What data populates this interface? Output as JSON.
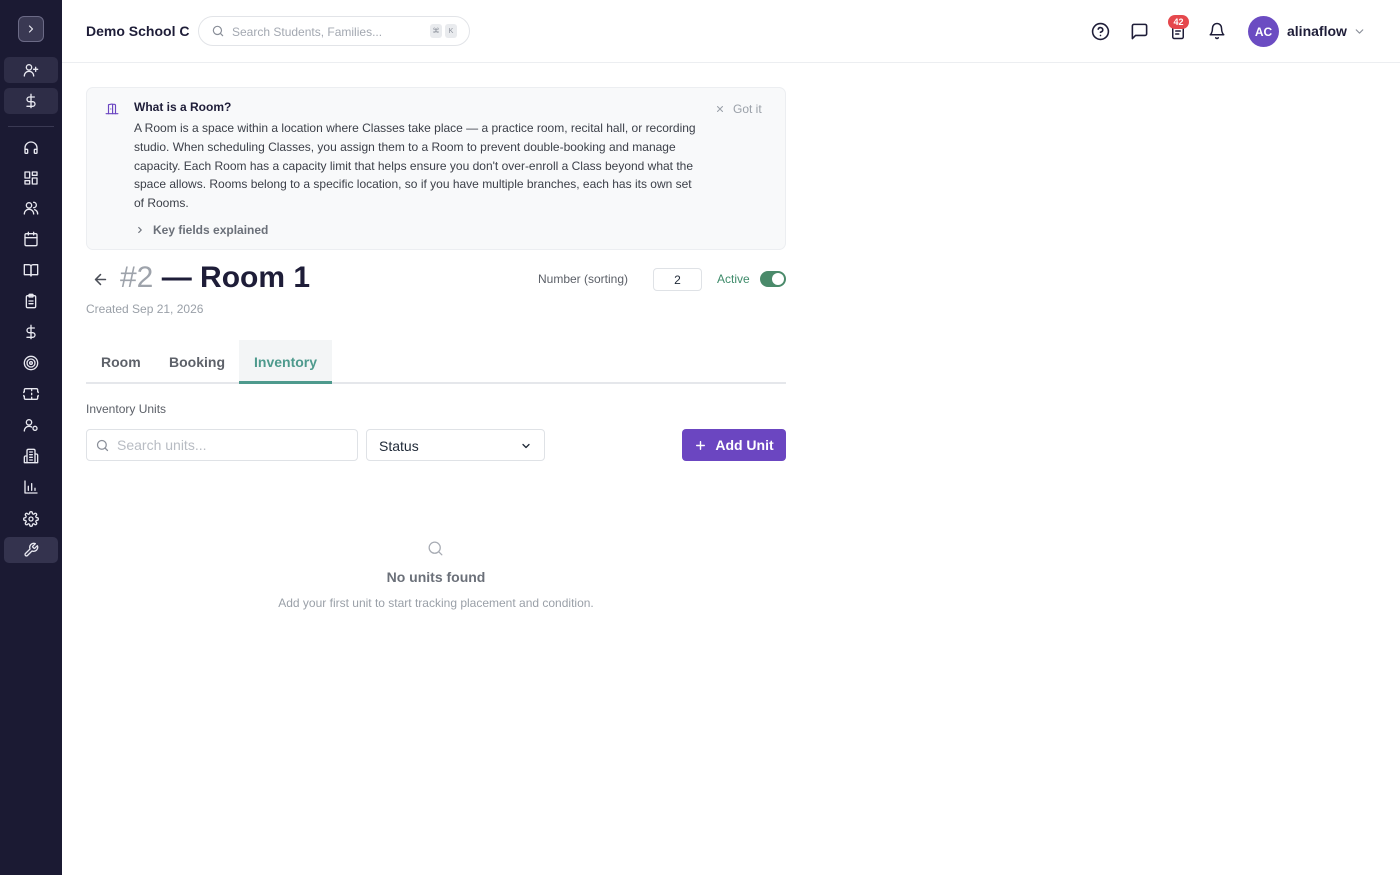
{
  "header": {
    "school_name": "Demo School C",
    "search_placeholder": "Search Students, Families...",
    "shortcut_keys": [
      "⌘",
      "K"
    ],
    "notification_count": "42",
    "user": {
      "initials": "AC",
      "name": "alinaflow"
    }
  },
  "sidebar": {
    "icons": [
      "chevron-right-icon",
      "user-plus-icon",
      "dollar-icon",
      "headset-icon",
      "grid-icon",
      "users-icon",
      "calendar-icon",
      "book-icon",
      "clipboard-icon",
      "dollar-icon",
      "target-icon",
      "ticket-icon",
      "user-cog-icon",
      "building-icon",
      "chart-icon",
      "gear-icon",
      "wrench-icon"
    ],
    "active_item": "wrench-icon"
  },
  "info": {
    "title": "What is a Room?",
    "body": "A Room is a space within a location where Classes take place — a practice room, recital hall, or recording studio. When scheduling Classes, you assign them to a Room to prevent double-booking and manage capacity. Each Room has a capacity limit that helps ensure you don't over-enroll a Class beyond what the space allows. Rooms belong to a specific location, so if you have multiple branches, each has its own set of Rooms.",
    "dismiss_label": "Got it",
    "key_fields_label": "Key fields explained"
  },
  "room": {
    "number": "#2",
    "title": "— Room 1",
    "created": "Created Sep 21, 2026",
    "sort_label": "Number (sorting)",
    "sort_value": "2",
    "active_label": "Active",
    "active": true
  },
  "tabs": [
    {
      "label": "Room",
      "active": false
    },
    {
      "label": "Booking",
      "active": false
    },
    {
      "label": "Inventory",
      "active": true
    }
  ],
  "inventory": {
    "section_label": "Inventory Units",
    "search_placeholder": "Search units...",
    "status_label": "Status",
    "add_button_label": "Add Unit",
    "empty_title": "No units found",
    "empty_subtitle": "Add your first unit to start tracking placement and condition."
  },
  "colors": {
    "sidebar_bg": "#1b1a33",
    "primary": "#6b46c1",
    "tab_active": "#4e9a8d",
    "active_toggle": "#4a8a6a",
    "badge": "#e5484d"
  }
}
